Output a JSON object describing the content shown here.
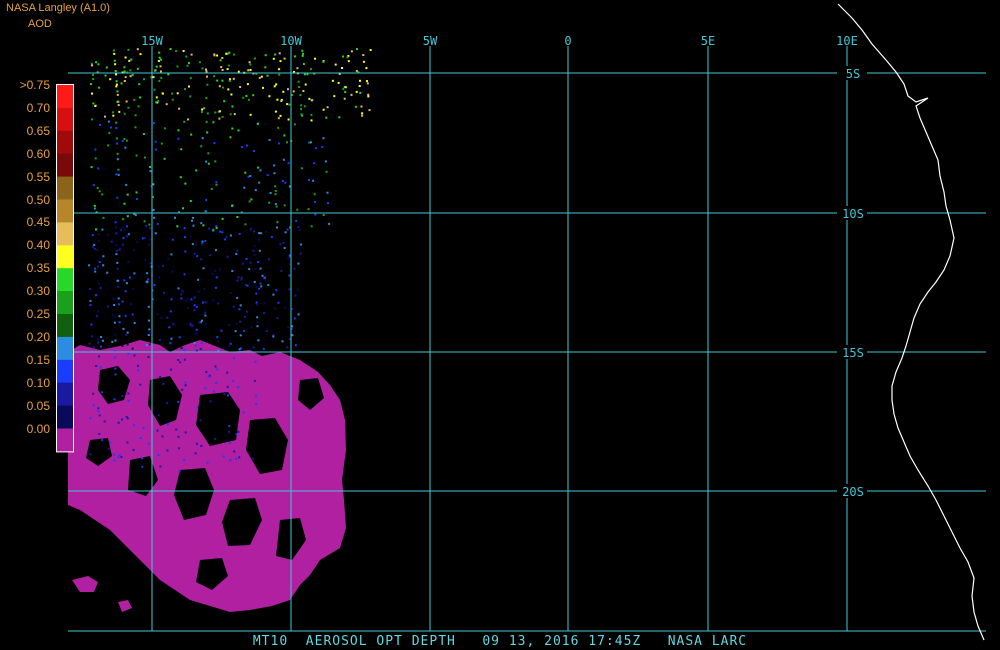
{
  "header": {
    "source": "NASA Langley (A1.0)",
    "product": "AOD"
  },
  "legend": {
    "labels": [
      ">0.75",
      "0.70",
      "0.65",
      "0.60",
      "0.55",
      "0.50",
      "0.45",
      "0.40",
      "0.35",
      "0.30",
      "0.25",
      "0.20",
      "0.15",
      "0.10",
      "0.05",
      "0.00"
    ],
    "colors": [
      "#ff1a1a",
      "#d80f0f",
      "#a00a0a",
      "#7a0a0a",
      "#8a6418",
      "#b8862a",
      "#e6bd5a",
      "#ffff20",
      "#28d828",
      "#1aa01a",
      "#106010",
      "#2c8ce0",
      "#1a3cff",
      "#1a1aa0",
      "#0a0a5a",
      "#b020a0"
    ]
  },
  "map": {
    "longitude_labels": [
      "15W",
      "10W",
      "5W",
      "0",
      "5E",
      "10E"
    ],
    "latitude_labels": [
      "5S",
      "10S",
      "15S",
      "20S"
    ],
    "grid_color": "#40c8d8",
    "coast_color": "#ffffff",
    "aod_low_color": "#b020a0"
  },
  "footer": {
    "text": "MT10  AEROSOL OPT DEPTH   09 13, 2016 17:45Z   NASA LARC"
  }
}
